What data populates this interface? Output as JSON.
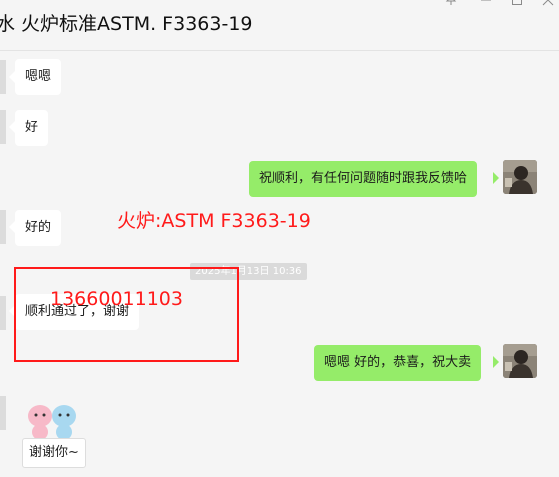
{
  "header": {
    "title": "水 火炉标准ASTM. F3363-19",
    "pin_icon": "pin-icon",
    "minimize_icon": "minimize-icon",
    "maximize_icon": "maximize-icon",
    "close_icon": "close-icon"
  },
  "messages": [
    {
      "side": "in",
      "text": "嗯嗯"
    },
    {
      "side": "in",
      "text": "好"
    },
    {
      "side": "out",
      "text": "祝顺利，有任何问题随时跟我反馈哈"
    },
    {
      "side": "in",
      "text": "好的"
    },
    {
      "side": "in",
      "text": "顺利通过了，谢谢"
    },
    {
      "side": "out",
      "text": "嗯嗯 好的，恭喜，祝大卖"
    }
  ],
  "timestamp": "2025年1月13日 10:36",
  "annotations": {
    "product": "火炉:ASTM F3363-19",
    "phone": "13660011103",
    "color": "#ff1a1a"
  },
  "sticker": {
    "caption": "谢谢你~",
    "icon": "two-cartoon-figures-sticker"
  },
  "colors": {
    "background": "#f5f5f5",
    "incoming_bubble": "#ffffff",
    "outgoing_bubble": "#95ec69"
  }
}
